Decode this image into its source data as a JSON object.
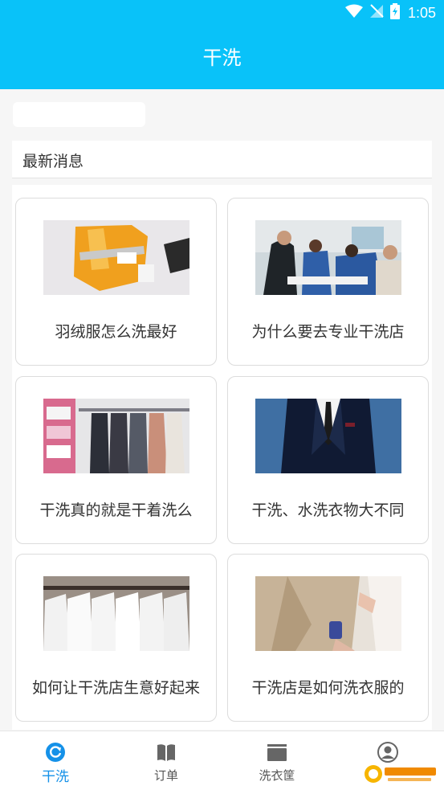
{
  "status": {
    "time": "1:05",
    "icons": [
      "wifi-icon",
      "no-signal-icon",
      "battery-icon"
    ]
  },
  "header": {
    "title": "干洗"
  },
  "search": {
    "placeholder": ""
  },
  "news": {
    "section_title": "最新消息"
  },
  "cards": [
    {
      "title": "羽绒服怎么洗最好"
    },
    {
      "title": "为什么要去专业干洗店"
    },
    {
      "title": "干洗真的就是干着洗么"
    },
    {
      "title": "干洗、水洗衣物大不同"
    },
    {
      "title": "如何让干洗店生意好起来"
    },
    {
      "title": "干洗店是如何洗衣服的"
    }
  ],
  "tabbar": {
    "items": [
      {
        "label": "干洗",
        "icon": "refresh-circle-icon",
        "active": true
      },
      {
        "label": "订单",
        "icon": "book-icon",
        "active": false
      },
      {
        "label": "洗衣筐",
        "icon": "basket-icon",
        "active": false
      },
      {
        "label": "",
        "icon": "user-icon",
        "active": false
      }
    ]
  },
  "colors": {
    "primary": "#09c2f9",
    "tab_active": "#1591e8"
  }
}
